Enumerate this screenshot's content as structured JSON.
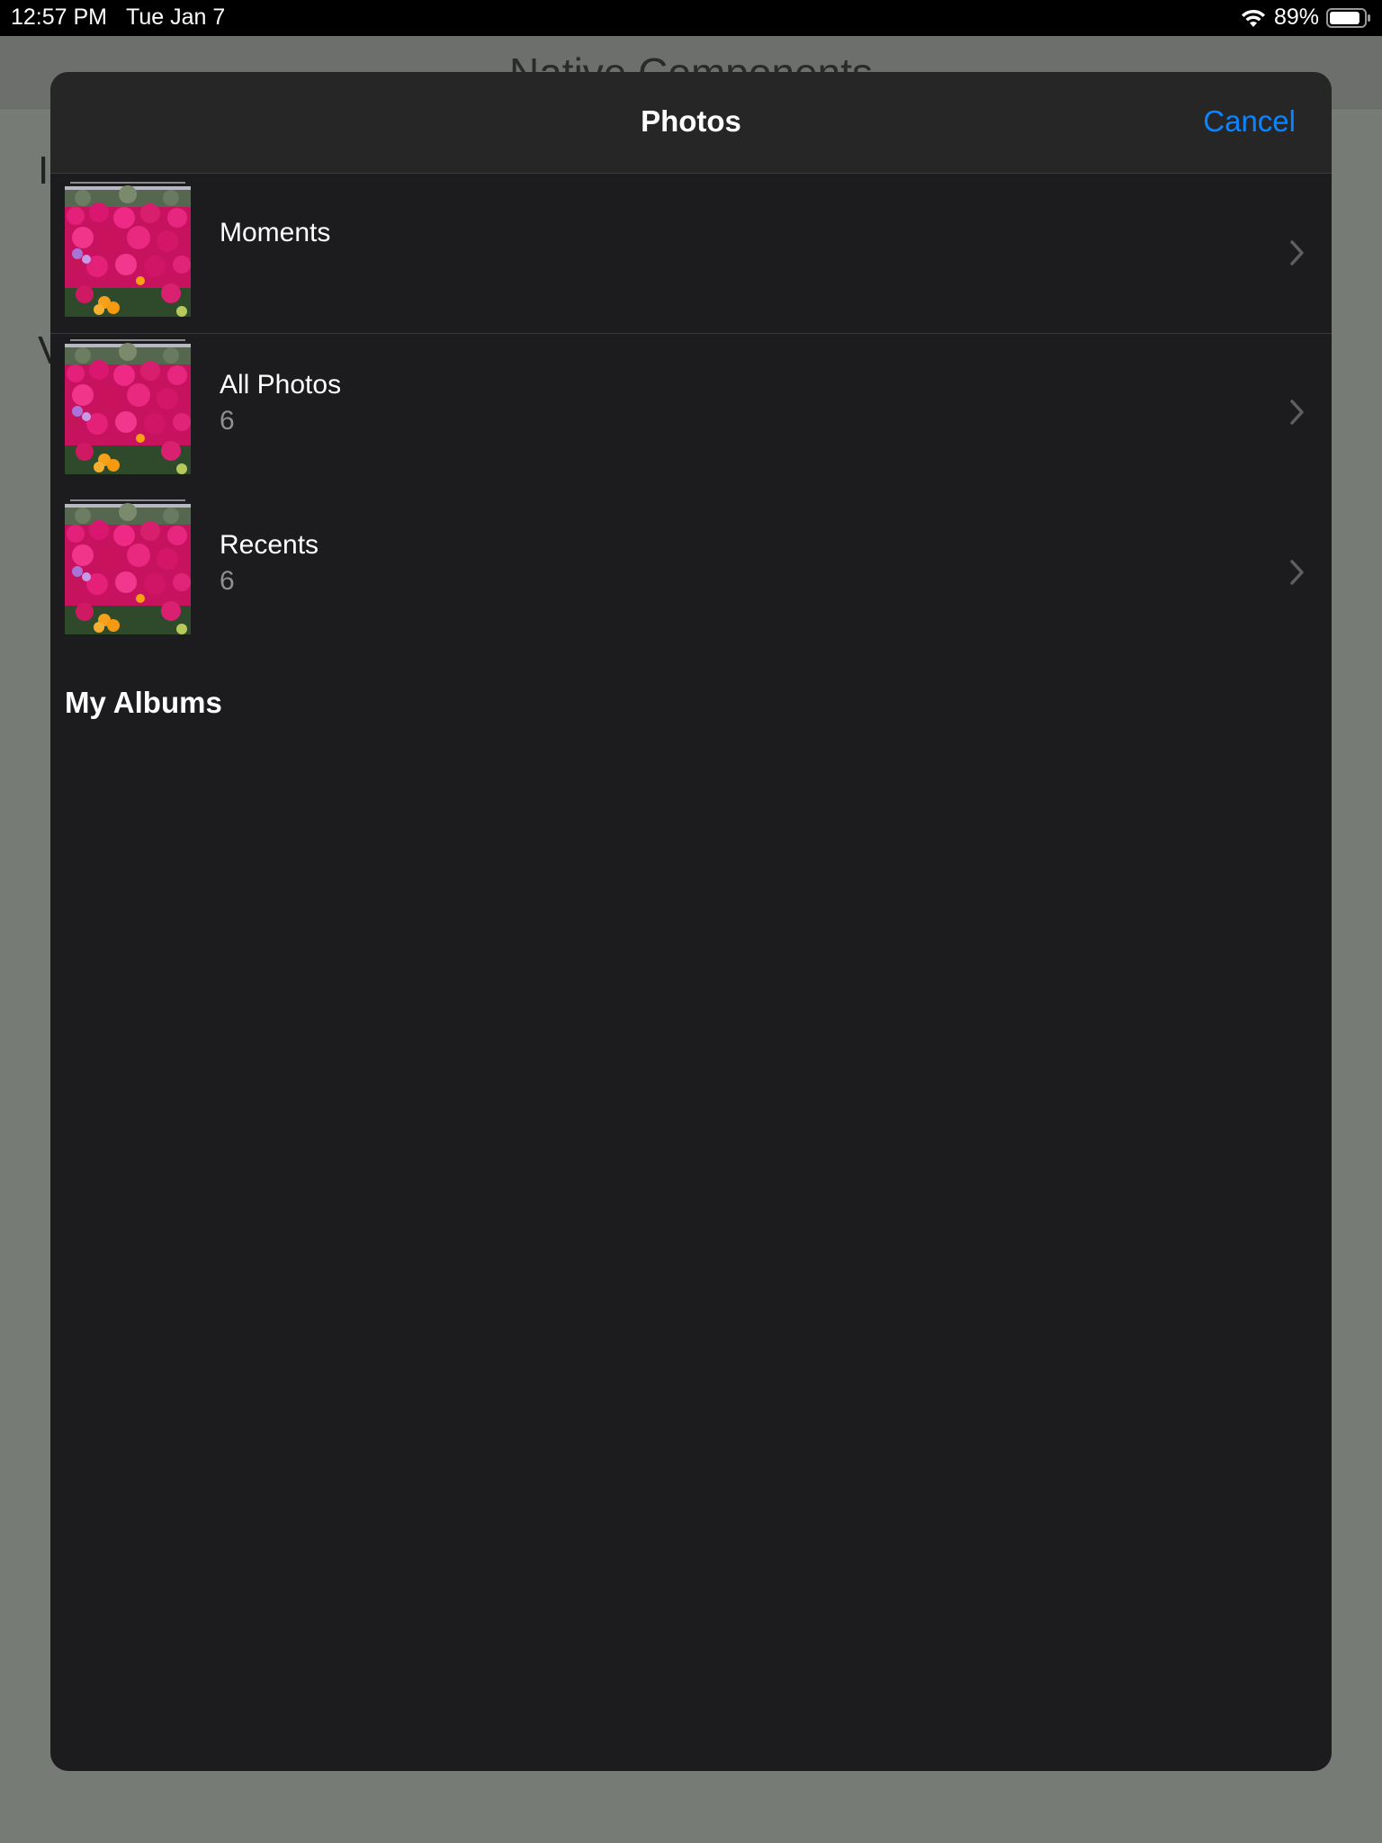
{
  "status_bar": {
    "time": "12:57 PM",
    "date": "Tue Jan 7",
    "battery_percent": "89%",
    "battery_level": 0.89,
    "icons": [
      "wifi-icon",
      "battery-icon"
    ]
  },
  "background_page": {
    "title": "Native Components",
    "text_fragments": [
      "I",
      "V"
    ]
  },
  "sheet": {
    "title": "Photos",
    "cancel_label": "Cancel",
    "albums": [
      {
        "title": "Moments",
        "count": ""
      },
      {
        "title": "All Photos",
        "count": "6"
      },
      {
        "title": "Recents",
        "count": "6"
      }
    ],
    "section_title": "My Albums"
  },
  "colors": {
    "accent": "#0a84ff",
    "sheet_background": "#1c1c1e",
    "header_background": "#262627",
    "secondary_text": "#8e8e93"
  }
}
